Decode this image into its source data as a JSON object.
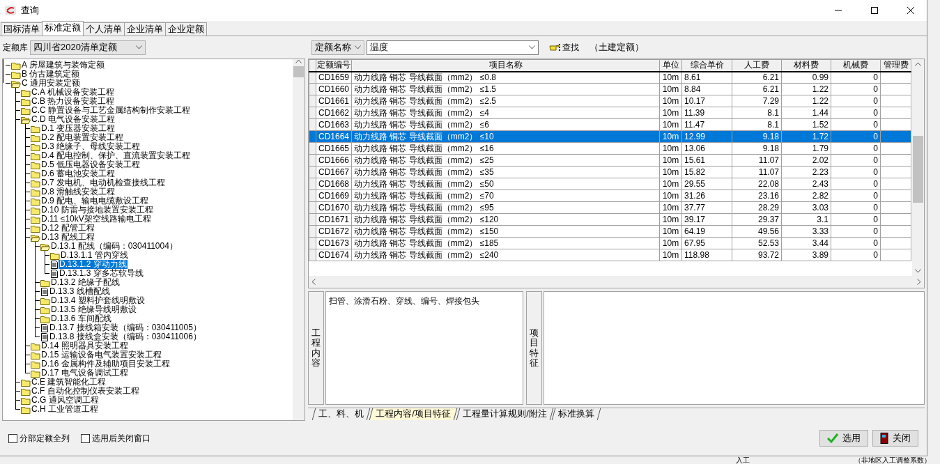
{
  "window": {
    "title": "查询"
  },
  "tabs": [
    {
      "label": "国标清单",
      "selected": false
    },
    {
      "label": "标准定额",
      "selected": true
    },
    {
      "label": "个人清单",
      "selected": false
    },
    {
      "label": "企业清单",
      "selected": false
    },
    {
      "label": "企业定额",
      "selected": false
    }
  ],
  "library": {
    "label": "定额库",
    "value": "四川省2020清单定额"
  },
  "search": {
    "field": "定额名称",
    "value": "温度",
    "button": "查找",
    "note": "（土建定额）"
  },
  "tree": [
    {
      "label": "A 房屋建筑与装饰定额",
      "kind": "folder",
      "expanded": false,
      "selected": false
    },
    {
      "label": "B 仿古建筑定额",
      "kind": "folder",
      "expanded": false,
      "selected": false
    },
    {
      "label": "C 通用安装定额",
      "kind": "folder",
      "expanded": true,
      "selected": false,
      "children": [
        {
          "label": "C.A 机械设备安装工程",
          "kind": "folder",
          "expanded": false,
          "selected": false
        },
        {
          "label": "C.B 热力设备安装工程",
          "kind": "folder",
          "expanded": false,
          "selected": false
        },
        {
          "label": "C.C 静置设备与工艺金属结构制作安装工程",
          "kind": "folder",
          "expanded": false,
          "selected": false
        },
        {
          "label": "C.D 电气设备安装工程",
          "kind": "folder",
          "expanded": true,
          "selected": false,
          "children": [
            {
              "label": "D.1 变压器安装工程",
              "kind": "folder",
              "expanded": false,
              "selected": false
            },
            {
              "label": "D.2 配电装置安装工程",
              "kind": "folder",
              "expanded": false,
              "selected": false
            },
            {
              "label": "D.3 绝缘子、母线安装工程",
              "kind": "folder",
              "expanded": false,
              "selected": false
            },
            {
              "label": "D.4 配电控制、保护、直流装置安装工程",
              "kind": "folder",
              "expanded": false,
              "selected": false
            },
            {
              "label": "D.5 低压电器设备安装工程",
              "kind": "folder",
              "expanded": false,
              "selected": false
            },
            {
              "label": "D.6 蓄电池安装工程",
              "kind": "folder",
              "expanded": false,
              "selected": false
            },
            {
              "label": "D.7 发电机、电动机检查接线工程",
              "kind": "folder",
              "expanded": false,
              "selected": false
            },
            {
              "label": "D.8 滑触线安装工程",
              "kind": "folder",
              "expanded": false,
              "selected": false
            },
            {
              "label": "D.9 配电、输电电缆敷设工程",
              "kind": "folder",
              "expanded": false,
              "selected": false
            },
            {
              "label": "D.10 防雷与接地装置安装工程",
              "kind": "folder",
              "expanded": false,
              "selected": false
            },
            {
              "label": "D.11 ≤10kV架空线路输电工程",
              "kind": "folder",
              "expanded": false,
              "selected": false
            },
            {
              "label": "D.12 配管工程",
              "kind": "folder",
              "expanded": false,
              "selected": false
            },
            {
              "label": "D.13 配线工程",
              "kind": "folder",
              "expanded": true,
              "selected": false,
              "children": [
                {
                  "label": "D.13.1 配线（编码：030411004）",
                  "kind": "folder",
                  "expanded": true,
                  "selected": false,
                  "children": [
                    {
                      "label": "D.13.1.1 管内穿线",
                      "kind": "folder",
                      "expanded": false,
                      "selected": false
                    },
                    {
                      "label": "D.13.1.2 穿动力线",
                      "kind": "doc",
                      "selected": true
                    },
                    {
                      "label": "D.13.1.3 穿多芯软导线",
                      "kind": "doc",
                      "selected": false
                    }
                  ]
                },
                {
                  "label": "D.13.2 绝缘子配线",
                  "kind": "folder",
                  "expanded": false,
                  "selected": false
                },
                {
                  "label": "D.13.3 线槽配线",
                  "kind": "doc",
                  "selected": false
                },
                {
                  "label": "D.13.4 塑料护套线明敷设",
                  "kind": "folder",
                  "expanded": false,
                  "selected": false
                },
                {
                  "label": "D.13.5 绝缘导线明敷设",
                  "kind": "folder",
                  "expanded": false,
                  "selected": false
                },
                {
                  "label": "D.13.6 车间配线",
                  "kind": "folder",
                  "expanded": false,
                  "selected": false
                },
                {
                  "label": "D.13.7 接线箱安装（编码：030411005）",
                  "kind": "doc",
                  "selected": false
                },
                {
                  "label": "D.13.8 接线盒安装（编码：030411006）",
                  "kind": "doc",
                  "selected": false
                }
              ]
            },
            {
              "label": "D.14 照明器具安装工程",
              "kind": "folder",
              "expanded": false,
              "selected": false
            },
            {
              "label": "D.15 运输设备电气装置安装工程",
              "kind": "folder",
              "expanded": false,
              "selected": false
            },
            {
              "label": "D.16 金属构件及辅助项目安装工程",
              "kind": "folder",
              "expanded": false,
              "selected": false
            },
            {
              "label": "D.17 电气设备调试工程",
              "kind": "folder",
              "expanded": false,
              "selected": false
            }
          ]
        },
        {
          "label": "C.E 建筑智能化工程",
          "kind": "folder",
          "expanded": false,
          "selected": false
        },
        {
          "label": "C.F 自动化控制仪表安装工程",
          "kind": "folder",
          "expanded": false,
          "selected": false
        },
        {
          "label": "C.G 通风空调工程",
          "kind": "folder",
          "expanded": false,
          "selected": false
        },
        {
          "label": "C.H 工业管道工程",
          "kind": "folder",
          "expanded": false,
          "selected": false
        }
      ]
    }
  ],
  "table": {
    "columns": [
      "定额编号",
      "项目名称",
      "单位",
      "综合单价",
      "人工费",
      "材料费",
      "机械费",
      "管理费"
    ],
    "rows": [
      {
        "cells": [
          "CD1659",
          "动力线路 铜芯 导线截面（mm2） ≤0.8",
          "10m",
          "8.61",
          "6.21",
          "0.99",
          "0"
        ],
        "selected": false
      },
      {
        "cells": [
          "CD1660",
          "动力线路 铜芯 导线截面（mm2） ≤1.5",
          "10m",
          "8.84",
          "6.21",
          "1.22",
          "0"
        ],
        "selected": false
      },
      {
        "cells": [
          "CD1661",
          "动力线路 铜芯 导线截面（mm2） ≤2.5",
          "10m",
          "10.17",
          "7.29",
          "1.22",
          "0"
        ],
        "selected": false
      },
      {
        "cells": [
          "CD1662",
          "动力线路 铜芯 导线截面（mm2） ≤4",
          "10m",
          "11.39",
          "8.1",
          "1.44",
          "0"
        ],
        "selected": false
      },
      {
        "cells": [
          "CD1663",
          "动力线路 铜芯 导线截面（mm2） ≤6",
          "10m",
          "11.47",
          "8.1",
          "1.52",
          "0"
        ],
        "selected": false
      },
      {
        "cells": [
          "CD1664",
          "动力线路 铜芯 导线截面（mm2） ≤10",
          "10m",
          "12.99",
          "9.18",
          "1.72",
          "0"
        ],
        "selected": true
      },
      {
        "cells": [
          "CD1665",
          "动力线路 铜芯 导线截面（mm2） ≤16",
          "10m",
          "13.06",
          "9.18",
          "1.79",
          "0"
        ],
        "selected": false
      },
      {
        "cells": [
          "CD1666",
          "动力线路 铜芯 导线截面（mm2） ≤25",
          "10m",
          "15.61",
          "11.07",
          "2.02",
          "0"
        ],
        "selected": false
      },
      {
        "cells": [
          "CD1667",
          "动力线路 铜芯 导线截面（mm2） ≤35",
          "10m",
          "15.82",
          "11.07",
          "2.23",
          "0"
        ],
        "selected": false
      },
      {
        "cells": [
          "CD1668",
          "动力线路 铜芯 导线截面（mm2） ≤50",
          "10m",
          "29.55",
          "22.08",
          "2.43",
          "0"
        ],
        "selected": false
      },
      {
        "cells": [
          "CD1669",
          "动力线路 铜芯 导线截面（mm2） ≤70",
          "10m",
          "31.26",
          "23.16",
          "2.82",
          "0"
        ],
        "selected": false
      },
      {
        "cells": [
          "CD1670",
          "动力线路 铜芯 导线截面（mm2） ≤95",
          "10m",
          "37.77",
          "28.29",
          "3.03",
          "0"
        ],
        "selected": false
      },
      {
        "cells": [
          "CD1671",
          "动力线路 铜芯 导线截面（mm2） ≤120",
          "10m",
          "39.17",
          "29.37",
          "3.1",
          "0"
        ],
        "selected": false
      },
      {
        "cells": [
          "CD1672",
          "动力线路 铜芯 导线截面（mm2） ≤150",
          "10m",
          "64.19",
          "49.56",
          "3.33",
          "0"
        ],
        "selected": false
      },
      {
        "cells": [
          "CD1673",
          "动力线路 铜芯 导线截面（mm2） ≤185",
          "10m",
          "67.95",
          "52.53",
          "3.44",
          "0"
        ],
        "selected": false
      },
      {
        "cells": [
          "CD1674",
          "动力线路 铜芯 导线截面（mm2） ≤240",
          "10m",
          "118.98",
          "93.72",
          "3.89",
          "0"
        ],
        "selected": false
      }
    ]
  },
  "detail": {
    "content_label": "工程内容",
    "content": "扫管、涂滑石粉、穿线、编号、焊接包头",
    "feature_label": "项目特征"
  },
  "bottom_tabs": [
    {
      "label": "工、料、机",
      "selected": false
    },
    {
      "label": "工程内容/项目特征",
      "selected": true
    },
    {
      "label": "工程量计算规则/附注",
      "selected": false
    },
    {
      "label": "标准换算",
      "selected": false
    }
  ],
  "options": [
    {
      "label": "分部定额全列",
      "checked": false
    },
    {
      "label": "选用后关闭窗口",
      "checked": false
    }
  ],
  "buttons": [
    {
      "label": "选用",
      "kind": "confirm"
    },
    {
      "label": "关闭",
      "kind": "close"
    }
  ],
  "background": {
    "texts": [
      "入工",
      "（非地区入工调整系数）"
    ]
  }
}
